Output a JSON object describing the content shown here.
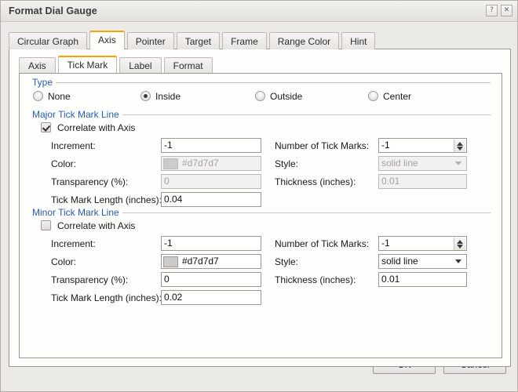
{
  "window": {
    "title": "Format Dial Gauge",
    "help_button": "?",
    "close_button": "✕"
  },
  "outer_tabs": [
    {
      "label": "Circular Graph",
      "active": false
    },
    {
      "label": "Axis",
      "active": true
    },
    {
      "label": "Pointer",
      "active": false
    },
    {
      "label": "Target",
      "active": false
    },
    {
      "label": "Frame",
      "active": false
    },
    {
      "label": "Range Color",
      "active": false
    },
    {
      "label": "Hint",
      "active": false
    }
  ],
  "inner_tabs": [
    {
      "label": "Axis",
      "active": false
    },
    {
      "label": "Tick Mark",
      "active": true
    },
    {
      "label": "Label",
      "active": false
    },
    {
      "label": "Format",
      "active": false
    }
  ],
  "type_group": {
    "legend": "Type",
    "options": [
      {
        "label": "None",
        "selected": false
      },
      {
        "label": "Inside",
        "selected": true
      },
      {
        "label": "Outside",
        "selected": false
      },
      {
        "label": "Center",
        "selected": false
      }
    ]
  },
  "major": {
    "legend": "Major Tick Mark Line",
    "correlate_label": "Correlate with Axis",
    "correlate_checked": true,
    "increment_label": "Increment:",
    "increment_value": "-1",
    "color_label": "Color:",
    "color_value": "#d7d7d7",
    "color_swatch": "#cbcbcb",
    "transparency_label": "Transparency (%):",
    "transparency_value": "0",
    "length_label": "Tick Mark Length (inches):",
    "length_value": "0.04",
    "number_label": "Number of Tick Marks:",
    "number_value": "-1",
    "style_label": "Style:",
    "style_value": "solid line",
    "thickness_label": "Thickness (inches):",
    "thickness_value": "0.01"
  },
  "minor": {
    "legend": "Minor Tick Mark Line",
    "correlate_label": "Correlate with Axis",
    "correlate_checked": false,
    "increment_label": "Increment:",
    "increment_value": "-1",
    "color_label": "Color:",
    "color_value": "#d7d7d7",
    "color_swatch": "#cbcbcb",
    "transparency_label": "Transparency (%):",
    "transparency_value": "0",
    "length_label": "Tick Mark Length (inches):",
    "length_value": "0.02",
    "number_label": "Number of Tick Marks:",
    "number_value": "-1",
    "style_label": "Style:",
    "style_value": "solid line",
    "thickness_label": "Thickness (inches):",
    "thickness_value": "0.01"
  },
  "footer": {
    "ok_label": "OK",
    "cancel_label": "Cancel"
  },
  "colors": {
    "accent_tab": "#f0a500",
    "legend_text": "#2a5db0"
  }
}
